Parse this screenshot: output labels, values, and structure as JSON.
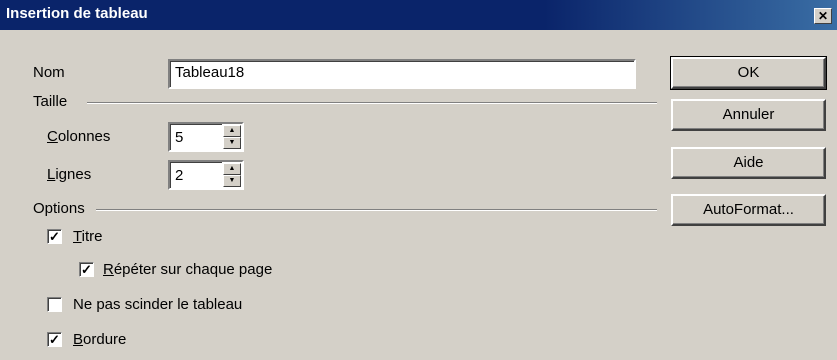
{
  "window": {
    "title": "Insertion de tableau",
    "close_glyph": "✕"
  },
  "name_field": {
    "label": "Nom",
    "value": "Tableau18"
  },
  "size_group": {
    "label": "Taille",
    "columns": {
      "label": "Colonnes",
      "value": "5"
    },
    "rows": {
      "label": "Lignes",
      "value": "2"
    }
  },
  "options_group": {
    "label": "Options",
    "items": [
      {
        "label": "Titre",
        "checked": true,
        "mark": "✓"
      },
      {
        "label": "Répéter sur chaque page",
        "checked": true,
        "mark": "✓"
      },
      {
        "label": "Ne pas scinder le tableau",
        "checked": false,
        "mark": ""
      },
      {
        "label": "Bordure",
        "checked": true,
        "mark": "✓"
      }
    ]
  },
  "buttons": {
    "ok": "OK",
    "cancel": "Annuler",
    "help": "Aide",
    "autoformat": "AutoFormat..."
  },
  "spin_glyphs": {
    "up": "▲",
    "down": "▼"
  },
  "colors": {
    "titlebar": "#0a246a",
    "dialog_bg": "#d4d0c8"
  }
}
